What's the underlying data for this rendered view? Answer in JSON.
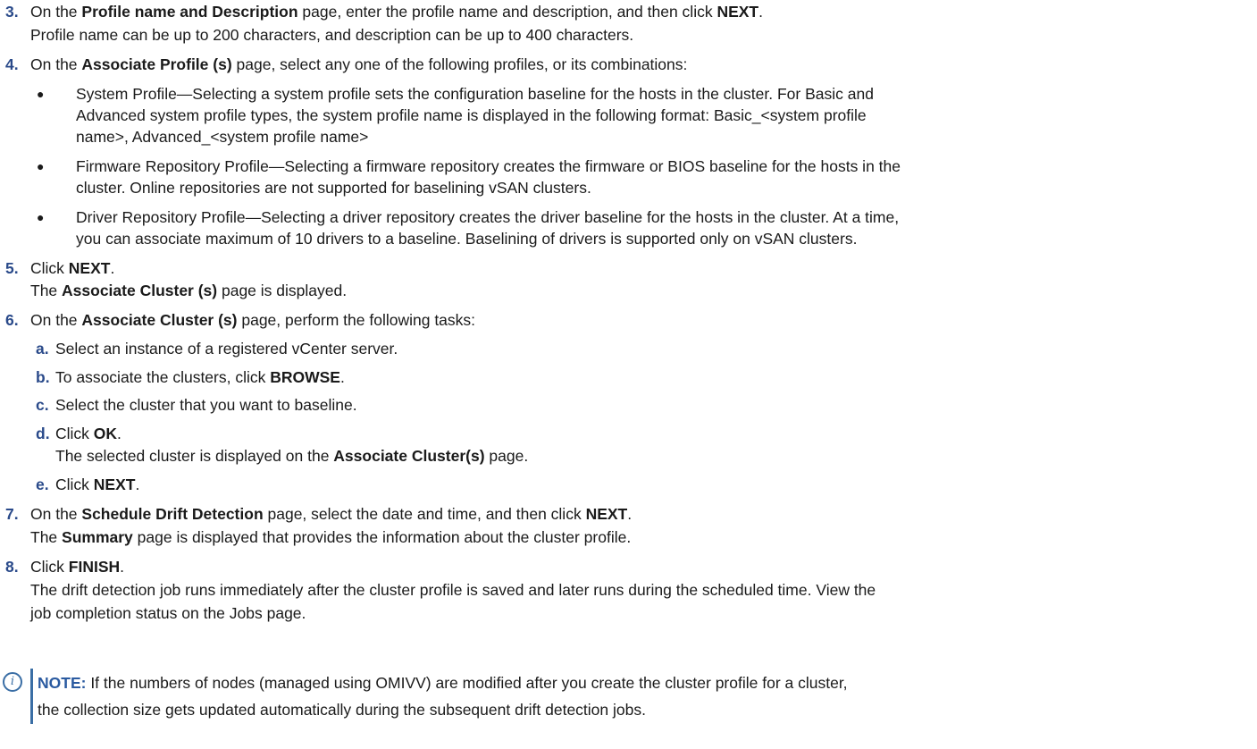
{
  "steps": [
    {
      "num": "3.",
      "lines": [
        [
          {
            "t": "On the "
          },
          {
            "t": "Profile name and Description",
            "b": true
          },
          {
            "t": " page, enter the profile name and description, and then click "
          },
          {
            "t": "NEXT",
            "b": true
          },
          {
            "t": "."
          }
        ],
        [
          {
            "t": "Profile name can be up to 200 characters, and description can be up to 400 characters."
          }
        ]
      ]
    },
    {
      "num": "4.",
      "lines": [
        [
          {
            "t": "On the "
          },
          {
            "t": "Associate Profile (s)",
            "b": true
          },
          {
            "t": " page, select any one of the following profiles, or its combinations:"
          }
        ]
      ],
      "bullets": [
        [
          "System Profile—Selecting a system profile sets the configuration baseline for the hosts in the cluster. For Basic and",
          "Advanced system profile types, the system profile name is displayed in the following format: Basic_<system profile",
          "name>, Advanced_<system profile name>"
        ],
        [
          "Firmware Repository Profile—Selecting a firmware repository creates the firmware or BIOS baseline for the hosts in the",
          "cluster. Online repositories are not supported for baselining vSAN clusters."
        ],
        [
          "Driver Repository Profile—Selecting a driver repository creates the driver baseline for the hosts in the cluster. At a time,",
          "you can associate maximum of 10 drivers to a baseline. Baselining of drivers is supported only on vSAN clusters."
        ]
      ]
    },
    {
      "num": "5.",
      "lines": [
        [
          {
            "t": "Click "
          },
          {
            "t": "NEXT",
            "b": true
          },
          {
            "t": "."
          }
        ],
        [
          {
            "t": "The "
          },
          {
            "t": "Associate Cluster (s)",
            "b": true
          },
          {
            "t": " page is displayed."
          }
        ]
      ]
    },
    {
      "num": "6.",
      "lines": [
        [
          {
            "t": "On the "
          },
          {
            "t": "Associate Cluster (s)",
            "b": true
          },
          {
            "t": " page, perform the following tasks:"
          }
        ]
      ],
      "substeps": [
        {
          "letter": "a.",
          "lines": [
            [
              {
                "t": "Select an instance of a registered vCenter server."
              }
            ]
          ]
        },
        {
          "letter": "b.",
          "lines": [
            [
              {
                "t": "To associate the clusters, click "
              },
              {
                "t": "BROWSE",
                "b": true
              },
              {
                "t": "."
              }
            ]
          ]
        },
        {
          "letter": "c.",
          "lines": [
            [
              {
                "t": "Select the cluster that you want to baseline."
              }
            ]
          ]
        },
        {
          "letter": "d.",
          "lines": [
            [
              {
                "t": "Click "
              },
              {
                "t": "OK",
                "b": true
              },
              {
                "t": "."
              }
            ],
            [
              {
                "t": "The selected cluster is displayed on the "
              },
              {
                "t": "Associate Cluster(s)",
                "b": true
              },
              {
                "t": " page."
              }
            ]
          ]
        },
        {
          "letter": "e.",
          "lines": [
            [
              {
                "t": "Click "
              },
              {
                "t": "NEXT",
                "b": true
              },
              {
                "t": "."
              }
            ]
          ]
        }
      ]
    },
    {
      "num": "7.",
      "lines": [
        [
          {
            "t": "On the "
          },
          {
            "t": "Schedule Drift Detection",
            "b": true
          },
          {
            "t": " page, select the date and time, and then click "
          },
          {
            "t": "NEXT",
            "b": true
          },
          {
            "t": "."
          }
        ],
        [
          {
            "t": "The "
          },
          {
            "t": "Summary",
            "b": true
          },
          {
            "t": " page is displayed that provides the information about the cluster profile."
          }
        ]
      ]
    },
    {
      "num": "8.",
      "lines": [
        [
          {
            "t": "Click "
          },
          {
            "t": "FINISH",
            "b": true
          },
          {
            "t": "."
          }
        ],
        [
          {
            "t": "The drift detection job runs immediately after the cluster profile is saved and later runs during the scheduled time. View the"
          }
        ],
        [
          {
            "t": "job completion status on the Jobs page."
          }
        ]
      ]
    }
  ],
  "note": {
    "label": "NOTE:",
    "line1": " If the numbers of nodes (managed using OMIVV) are modified after you create the cluster profile for a cluster,",
    "line2": "the collection size gets updated automatically during the subsequent drift detection jobs."
  },
  "icons": {
    "note": "info-circle-icon",
    "accent": "#3a6ea5"
  }
}
